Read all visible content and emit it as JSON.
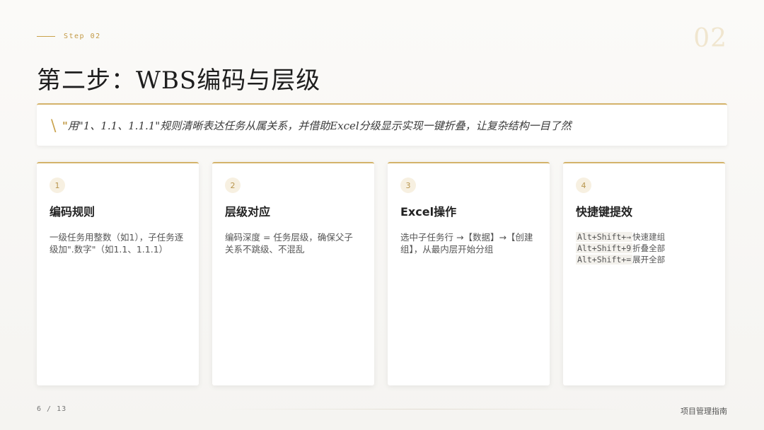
{
  "header": {
    "step_label": "Step 02",
    "big_number": "02",
    "title": "第二步：WBS编码与层级"
  },
  "quote": {
    "mark": "\\",
    "open": "\"",
    "text": "用\"1、1.1、1.1.1\"规则清晰表达任务从属关系，并借助Excel分级显示实现一键折叠，让复杂结构一目了然"
  },
  "cards": [
    {
      "num": "1",
      "title": "编码规则",
      "body": "一级任务用整数（如1），子任务逐级加\".数字\"（如1.1、1.1.1）"
    },
    {
      "num": "2",
      "title": "层级对应",
      "body": "编码深度 = 任务层级，确保父子关系不跳级、不混乱"
    },
    {
      "num": "3",
      "title": "Excel操作",
      "body": "选中子任务行 →【数据】→【创建组】，从最内层开始分组"
    },
    {
      "num": "4",
      "title": "快捷键提效",
      "lines": [
        {
          "key": "Alt+Shift+→",
          "desc": "快速建组"
        },
        {
          "key": "Alt+Shift+9",
          "desc": "折叠全部"
        },
        {
          "key": "Alt+Shift+=",
          "desc": "展开全部"
        }
      ]
    }
  ],
  "footer": {
    "page": "6 / 13",
    "doc_title": "项目管理指南"
  },
  "colors": {
    "accent": "#c9a24b",
    "badge_bg": "#f7f0e1"
  }
}
